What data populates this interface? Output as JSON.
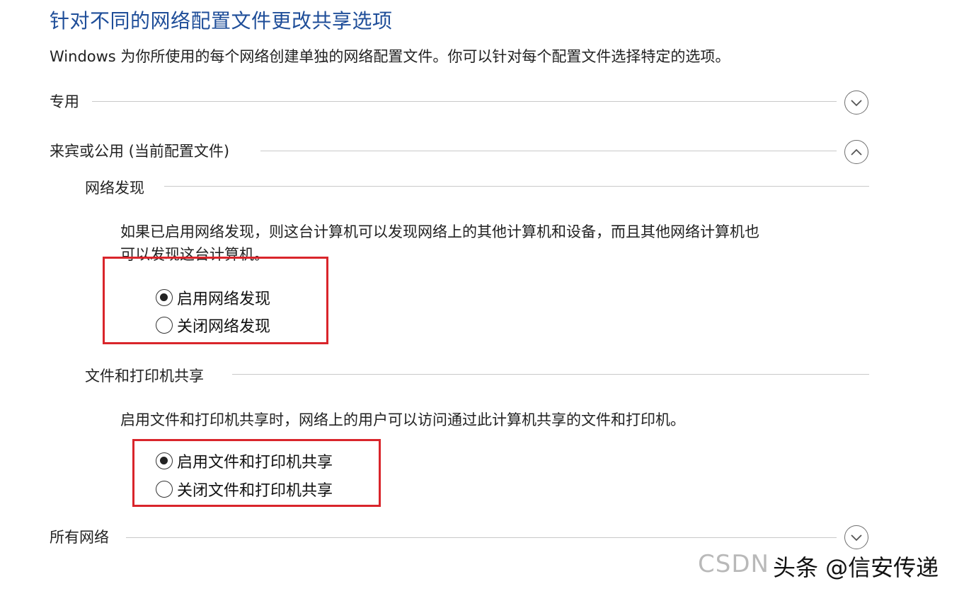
{
  "header": {
    "title": "针对不同的网络配置文件更改共享选项",
    "description": "Windows 为你所使用的每个网络创建单独的网络配置文件。你可以针对每个配置文件选择特定的选项。"
  },
  "profiles": {
    "private": {
      "label": "专用",
      "expanded": false
    },
    "guest_public": {
      "label": "来宾或公用 (当前配置文件)",
      "expanded": true
    },
    "all_networks": {
      "label": "所有网络",
      "expanded": false
    }
  },
  "network_discovery": {
    "title": "网络发现",
    "description_line1": "如果已启用网络发现，则这台计算机可以发现网络上的其他计算机和设备，而且其他网络计算机也",
    "description_line2": "可以发现这台计算机。",
    "options": [
      {
        "label": "启用网络发现",
        "selected": true
      },
      {
        "label": "关闭网络发现",
        "selected": false
      }
    ]
  },
  "file_printer_sharing": {
    "title": "文件和打印机共享",
    "description": "启用文件和打印机共享时，网络上的用户可以访问通过此计算机共享的文件和打印机。",
    "options": [
      {
        "label": "启用文件和打印机共享",
        "selected": true
      },
      {
        "label": "关闭文件和打印机共享",
        "selected": false
      }
    ]
  },
  "watermark": {
    "csdn_text": "CSDN",
    "source_text": "头条 @信安传递"
  },
  "colors": {
    "title_blue": "#1f4e99",
    "highlight_red": "#d9252b"
  },
  "icons": {
    "collapsed": "chevron-down-icon",
    "expanded": "chevron-up-icon"
  }
}
